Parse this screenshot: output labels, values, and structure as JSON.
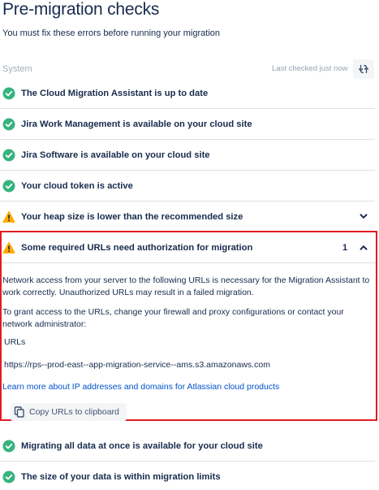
{
  "page": {
    "title": "Pre-migration checks",
    "subtitle": "You must fix these errors before running your migration"
  },
  "system": {
    "label": "System",
    "last_checked": "Last checked just now",
    "refresh_icon": "refresh-icon"
  },
  "checks": [
    {
      "label": "The Cloud Migration Assistant is up to date",
      "status": "success"
    },
    {
      "label": "Jira Work Management is available on your cloud site",
      "status": "success"
    },
    {
      "label": "Jira Software is available on your cloud site",
      "status": "success"
    },
    {
      "label": "Your cloud token is active",
      "status": "success"
    },
    {
      "label": "Your heap size is lower than the recommended size",
      "status": "warning"
    }
  ],
  "expanded_check": {
    "label": "Some required URLs need authorization for migration",
    "status": "warning",
    "count": "1",
    "paragraph1": "Network access from your server to the following URLs is necessary for the Migration Assistant to work correctly. Unauthorized URLs may result in a failed migration.",
    "paragraph2": "To grant access to the URLs, change your firewall and proxy configurations or contact your network administrator:",
    "urls_heading": "URLs",
    "url": "https://rps--prod-east--app-migration-service--ams.s3.amazonaws.com",
    "learn_more": "Learn more about IP addresses and domains for Atlassian cloud products",
    "copy_button": "Copy URLs to clipboard"
  },
  "checks_after": [
    {
      "label": "Migrating all data at once is available for your cloud site",
      "status": "success"
    },
    {
      "label": "The size of your data is within migration limits",
      "status": "success"
    }
  ],
  "colors": {
    "success": "#36b37e",
    "warning": "#ffab00",
    "highlight": "#e31b23",
    "link": "#0052cc"
  }
}
